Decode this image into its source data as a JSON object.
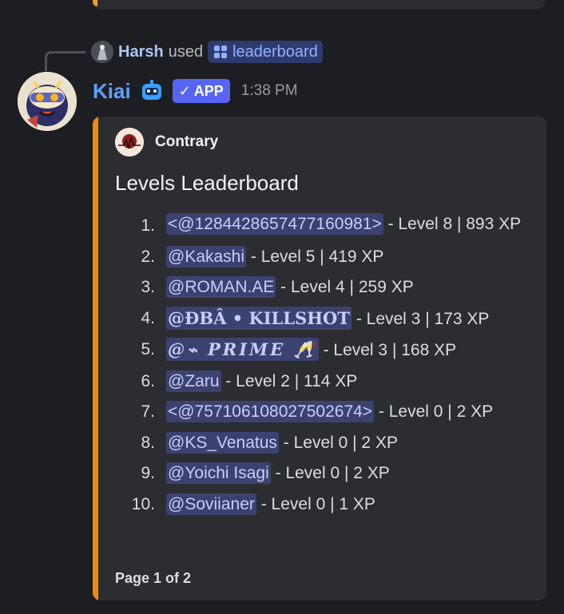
{
  "reply": {
    "user": "Harsh",
    "action": "used",
    "command": "leaderboard"
  },
  "message": {
    "bot_name": "Kiai",
    "app_badge": "APP",
    "timestamp": "1:38 PM"
  },
  "embed": {
    "accent_color": "#f08c10",
    "author": "Contrary",
    "title": "Levels Leaderboard",
    "entries": [
      {
        "rank": "1.",
        "user": "<@1284428657477160981>",
        "stats": " - Level 8 | 893 XP"
      },
      {
        "rank": "2.",
        "user": "@Kakashi",
        "stats": " - Level 5 | 419 XP"
      },
      {
        "rank": "3.",
        "user": "@ROMAN.AE",
        "stats": " - Level 4 | 259 XP"
      },
      {
        "rank": "4.",
        "user": "@ĐBÂ  • KILLSHOT",
        "stats": " - Level 3 | 173 XP"
      },
      {
        "rank": "5.",
        "user": "@⌁ PRIME 🥂",
        "stats": " - Level 3 | 168 XP"
      },
      {
        "rank": "6.",
        "user": "@Zaru",
        "stats": " - Level 2 | 114 XP"
      },
      {
        "rank": "7.",
        "user": "<@757106108027502674>",
        "stats": " - Level 0 | 2 XP"
      },
      {
        "rank": "8.",
        "user": "@KS_Venatus",
        "stats": " - Level 0 | 2 XP"
      },
      {
        "rank": "9.",
        "user": "@Yoichi Isagi",
        "stats": " - Level 0 | 2 XP"
      },
      {
        "rank": "10.",
        "user": "@Soviianer",
        "stats": " - Level 0 | 1 XP"
      }
    ],
    "footer": "Page 1 of 2"
  }
}
